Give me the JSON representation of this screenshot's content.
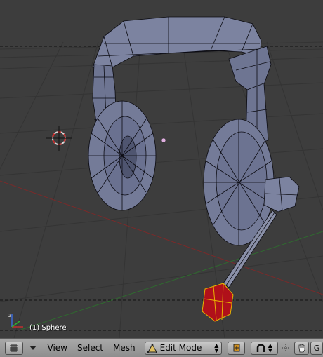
{
  "viewport": {
    "object_label": "(1) Sphere"
  },
  "header": {
    "menus": [
      "View",
      "Select",
      "Mesh"
    ],
    "mode": {
      "label": "Edit Mode",
      "icon": "edit-mode-triangle-icon"
    },
    "icons": [
      "editor-type-grid-icon",
      "header-collapse-icon",
      "pivot-point-icon",
      "proportional-edit-icon",
      "manipulator-icon",
      "hand-icon"
    ],
    "trailing_label": "G"
  },
  "colors": {
    "viewport_bg": "#3d3d3d",
    "grid": "#353535",
    "mesh_fill": "#7c83a0",
    "mesh_wire": "#0b0b12",
    "selected_fill": "#b0101a",
    "selected_wire": "#e8b400",
    "header_bg": "#9a9a9a"
  }
}
